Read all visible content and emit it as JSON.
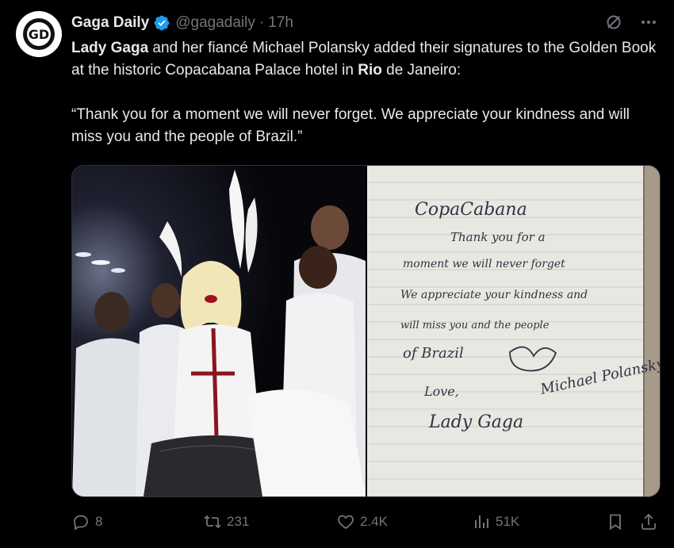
{
  "tweet": {
    "author_name": "Gaga Daily",
    "handle": "@gagadaily",
    "separator": "·",
    "time": "17h",
    "avatar_text": "GD",
    "verified_icon": "verified-badge-icon",
    "paragraph1": {
      "part1": "Lady Gaga",
      "part2": " and her fiancé Michael Polansky added their signatures to the Golden Book at the historic Copacabana Palace hotel in ",
      "part3": "Rio",
      "part4": " de Janeiro:"
    },
    "paragraph2": "“Thank you for a moment we will never forget. We appreciate your kindness and will miss you and the people of Brazil.”"
  },
  "handwriting": {
    "heading": "CopaCabana",
    "line1": "Thank you for a",
    "line2": "moment we will never forget",
    "line3": "We appreciate your kindness and",
    "line4": "will miss you and the people",
    "line5": "of Brazil",
    "closing": "Love,",
    "signature_gaga": "Lady Gaga",
    "signature_michael": "Michael Polansky"
  },
  "actions": {
    "replies": "8",
    "reposts": "231",
    "likes": "2.4K",
    "views": "51K"
  },
  "colors": {
    "background": "#000000",
    "text": "#e7e9ea",
    "muted": "#71767b",
    "verified": "#1d9bf0"
  }
}
